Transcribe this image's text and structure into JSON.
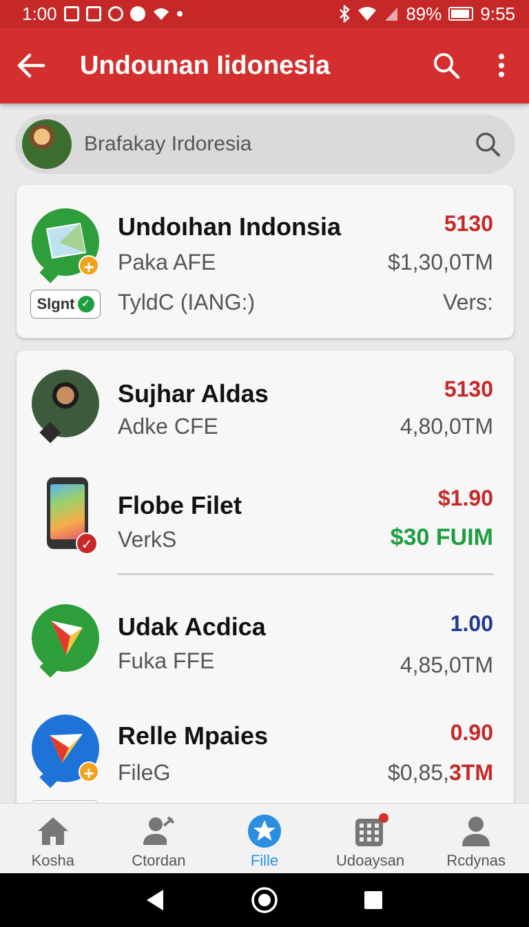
{
  "status_bar": {
    "time_left": "1:00",
    "battery": "89%",
    "time_right": "9:55"
  },
  "app_bar": {
    "title": "Undounan Iidonesia"
  },
  "search": {
    "text": "Brafakay Irdoresia"
  },
  "card1": {
    "title": "Undoıhan Indonsia",
    "subtitle": "Paka AFE",
    "detail": "TyldC (IANG:)",
    "amount": "5130",
    "value": "$1,30,0TM",
    "extra": "Vers:",
    "tag": "Slgnt"
  },
  "list": [
    {
      "title": "Sujhar Aldas",
      "subtitle": "Adke CFE",
      "amount": "5130",
      "value": "4,80,0TM"
    },
    {
      "title": "Flobe Filet",
      "subtitle": "VerkS",
      "amount": "$1.90",
      "value": "$30 FUIM"
    },
    {
      "title": "Udak Acdica",
      "subtitle": "Fuka FFE",
      "amount": "1.00",
      "value": "4,85,0TM"
    },
    {
      "title": "Relle Mpaies",
      "subtitle": "FileG",
      "amount": "0.90",
      "value_prefix": "$0,85,",
      "value_suffix": "3TM"
    }
  ],
  "bottom_nav": [
    {
      "label": "Kosha",
      "icon": "home-icon"
    },
    {
      "label": "Ctordan",
      "icon": "user-edit-icon"
    },
    {
      "label": "Fille",
      "icon": "star-icon",
      "active": true
    },
    {
      "label": "Udoaysan",
      "icon": "grid-icon"
    },
    {
      "label": "Rcdynas",
      "icon": "person-icon"
    }
  ],
  "colors": {
    "primary": "#d32f2f",
    "accent_red": "#c62828",
    "accent_green": "#1e9e40",
    "accent_navy": "#1f3a8f",
    "active_blue": "#2a8fe0"
  }
}
